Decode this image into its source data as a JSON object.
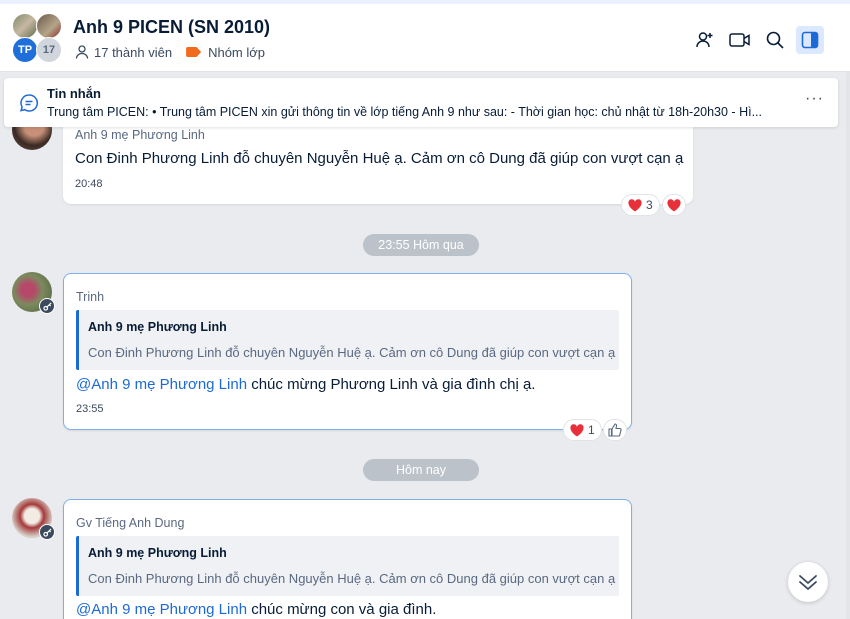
{
  "header": {
    "title": "Anh 9 PICEN (SN 2010)",
    "avatar_initials": "TP",
    "avatar_count": "17",
    "members": "17 thành viên",
    "group_type": "Nhóm lớp"
  },
  "pinned": {
    "title": "Tin nhắn",
    "text": "Trung tâm PICEN: • Trung tâm PICEN xin gửi thông tin về lớp tiếng Anh 9 như sau: - Thời gian học: chủ nhật từ 18h-20h30 - Hì...",
    "more": "···"
  },
  "messages": [
    {
      "sender": "Anh 9 mẹ Phương Linh",
      "text": "Con Đinh Phương Linh đỗ chuyên Nguyễn Huệ ạ. Cảm ơn cô Dung đã giúp con vượt cạn ạ",
      "time": "20:48",
      "reaction_count": "3"
    },
    {
      "sender": "Trinh",
      "quote_name": "Anh 9 mẹ Phương Linh",
      "quote_text": "Con Đinh Phương Linh đỗ chuyên Nguyễn Huệ ạ. Cảm ơn cô Dung đã giúp con vượt cạn ạ",
      "mention": "@Anh 9 mẹ Phương Linh",
      "text": " chúc mừng Phương Linh và gia đình chị ạ.",
      "time": "23:55",
      "reaction_count": "1"
    },
    {
      "sender": "Gv Tiếng Anh Dung",
      "quote_name": "Anh 9 mẹ Phương Linh",
      "quote_text": "Con Đinh Phương Linh đỗ chuyên Nguyễn Huệ ạ. Cảm ơn cô Dung đã giúp con vượt cạn ạ",
      "mention": "@Anh 9 mẹ Phương Linh",
      "text": " chúc mừng con và gia đình."
    }
  ],
  "dividers": {
    "yesterday": "23:55 Hôm qua",
    "today": "Hôm nay"
  },
  "colors": {
    "accent": "#1d6ad6",
    "background": "#e9ebee",
    "tag": "#f26b1d",
    "heart": "#e8303a"
  },
  "icons": [
    "add-member-icon",
    "video-call-icon",
    "search-icon",
    "sidebar-toggle-icon",
    "chat-bubble-icon",
    "heart-icon",
    "like-icon",
    "key-icon",
    "double-chevron-down-icon"
  ]
}
